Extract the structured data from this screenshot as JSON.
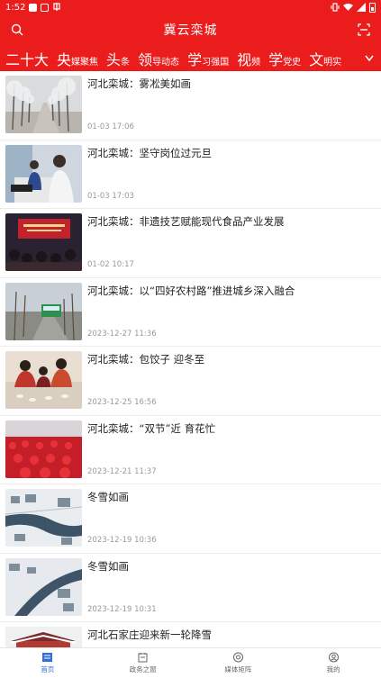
{
  "status_bar": {
    "time": "1:52"
  },
  "header": {
    "title": "冀云栾城"
  },
  "tabs": [
    {
      "big": "二十大",
      "small": ""
    },
    {
      "big": "央",
      "small": "媒聚焦"
    },
    {
      "big": "头",
      "small": "条"
    },
    {
      "big": "领",
      "small": "导动态"
    },
    {
      "big": "学",
      "small": "习强国"
    },
    {
      "big": "视",
      "small": "频"
    },
    {
      "big": "学",
      "small": "党史"
    },
    {
      "big": "文",
      "small": "明实"
    }
  ],
  "news": [
    {
      "title": "河北栾城：雾凇美如画",
      "date": "01-03 17:06"
    },
    {
      "title": "河北栾城：坚守岗位过元旦",
      "date": "01-03 17:03"
    },
    {
      "title": "河北栾城：非遗技艺赋能现代食品产业发展",
      "date": "01-02 10:17"
    },
    {
      "title": "河北栾城：以“四好农村路”推进城乡深入融合",
      "date": "2023-12-27 11:36"
    },
    {
      "title": "河北栾城：包饺子 迎冬至",
      "date": "2023-12-25 16:56"
    },
    {
      "title": "河北栾城：“双节”近 育花忙",
      "date": "2023-12-21 11:37"
    },
    {
      "title": "冬雪如画",
      "date": "2023-12-19 10:36"
    },
    {
      "title": "冬雪如画",
      "date": "2023-12-19 10:31"
    },
    {
      "title": "河北石家庄迎来新一轮降雪",
      "date": ""
    }
  ],
  "bottom_nav": [
    {
      "label": "首页",
      "icon": "home-icon"
    },
    {
      "label": "政务之窗",
      "icon": "government-icon"
    },
    {
      "label": "媒体矩阵",
      "icon": "media-icon"
    },
    {
      "label": "我的",
      "icon": "profile-icon"
    }
  ],
  "colors": {
    "primary": "#ea1c1c",
    "nav_active": "#2e6fd8"
  }
}
